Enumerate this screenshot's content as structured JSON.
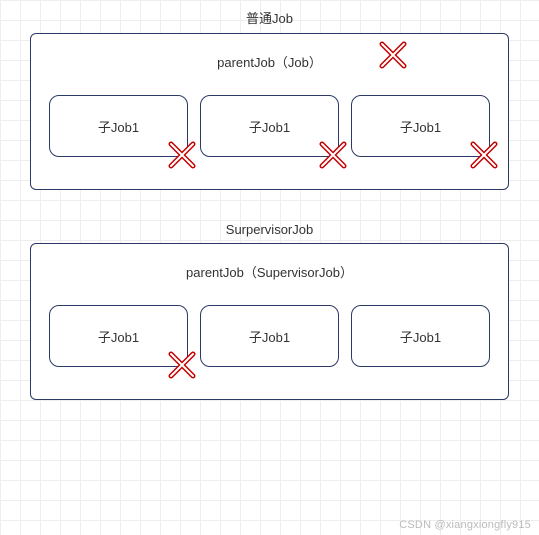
{
  "section1": {
    "title": "普通Job",
    "panel_title": "parentJob（Job）",
    "children": [
      "子Job1",
      "子Job1",
      "子Job1"
    ]
  },
  "section2": {
    "title": "SurpervisorJob",
    "panel_title": "parentJob（SupervisorJob）",
    "children": [
      "子Job1",
      "子Job1",
      "子Job1"
    ]
  },
  "watermark": "CSDN @xiangxiongfly915"
}
